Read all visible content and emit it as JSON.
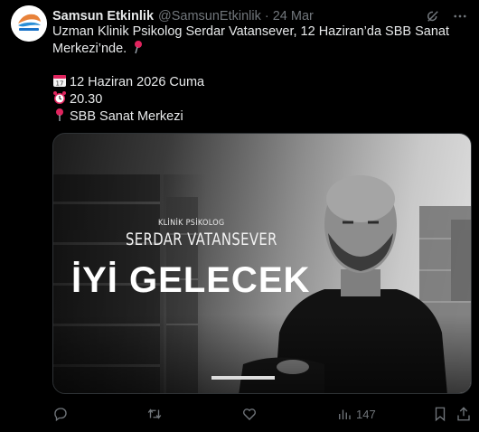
{
  "tweet": {
    "display_name": "Samsun Etkinlik",
    "handle": "@SamsunEtkinlik",
    "separator": "·",
    "date": "24 Mar",
    "text_line1": "Uzman Klinik Psikolog Serdar Vatansever, 12 Haziran’da SBB Sanat",
    "text_line2": "Merkezi’nde.",
    "detail_date": "12 Haziran 2026 Cuma",
    "detail_time": "20.30",
    "detail_place": "SBB Sanat Merkezi"
  },
  "poster": {
    "subtitle": "KLİNİK PSİKOLOG",
    "name": "SERDAR VATANSEVER",
    "title": "İYİ GELECEK"
  },
  "actions": {
    "views": "147"
  },
  "icons": [
    "grok-icon",
    "more-icon",
    "pushpin-icon",
    "calendar-icon",
    "alarm-clock-icon",
    "reply-icon",
    "retweet-icon",
    "like-icon",
    "views-icon",
    "bookmark-icon",
    "share-icon"
  ],
  "colors": {
    "background": "#000000",
    "text": "#e7e9ea",
    "secondary": "#71767b",
    "border": "#2f3336"
  }
}
